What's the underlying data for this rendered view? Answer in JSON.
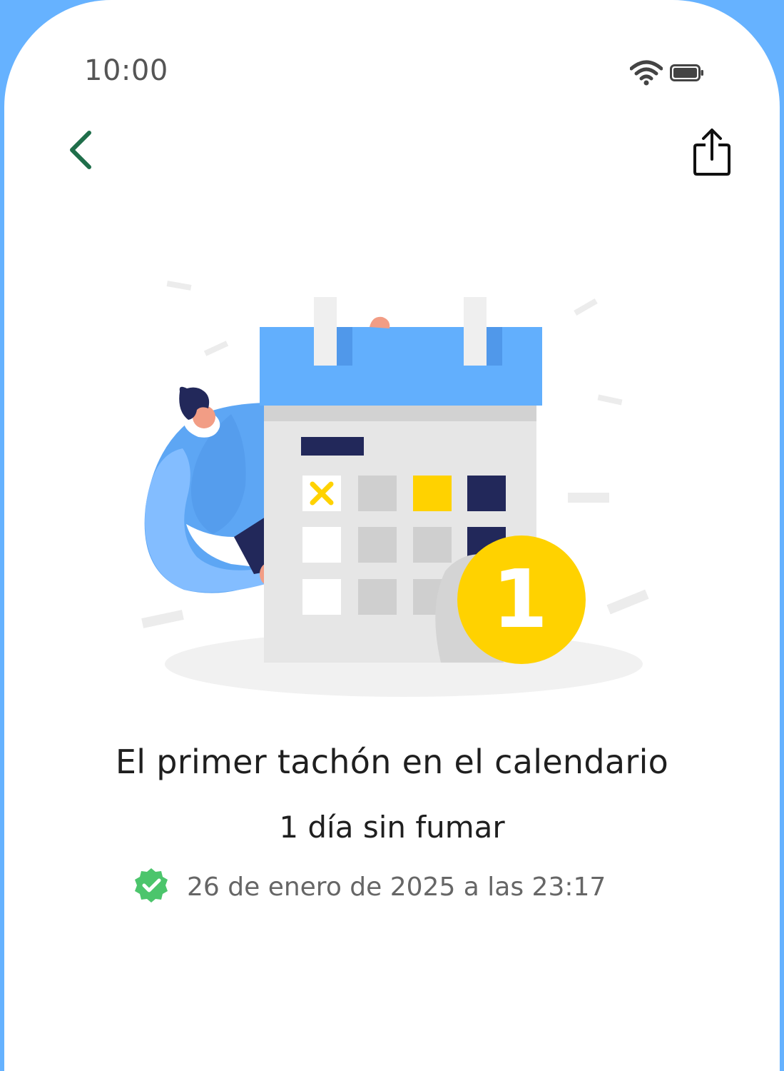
{
  "status_bar": {
    "time": "10:00",
    "icons": [
      "wifi-icon",
      "battery-icon"
    ]
  },
  "nav": {
    "back_icon": "chevron-left-icon",
    "share_icon": "share-icon"
  },
  "illustration": {
    "badge_number": "1"
  },
  "achievement": {
    "title": "El primer tachón en el calendario",
    "subtitle": "1 día sin fumar",
    "date": "26 de enero de 2025 a las 23:17",
    "verified_icon": "verified-badge-icon"
  },
  "colors": {
    "accent_green": "#1f6e4a",
    "calendar_blue": "#62affd",
    "badge_yellow": "#ffd200",
    "navy": "#22285a",
    "verified_green": "#4cc56c"
  }
}
